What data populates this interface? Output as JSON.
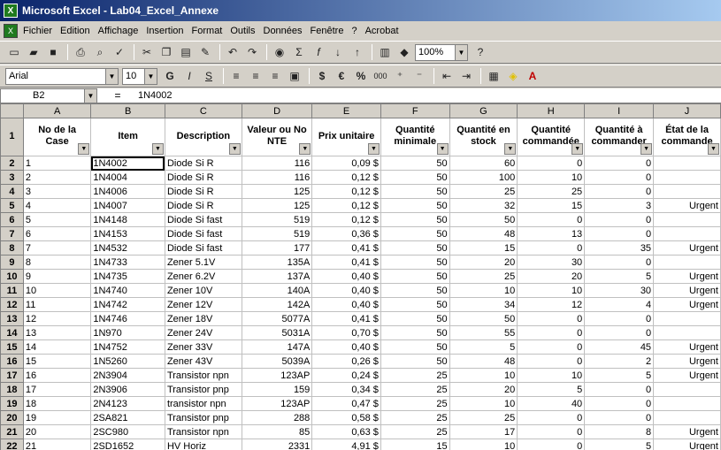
{
  "title": "Microsoft Excel - Lab04_Excel_Annexe",
  "menu": [
    "Fichier",
    "Edition",
    "Affichage",
    "Insertion",
    "Format",
    "Outils",
    "Données",
    "Fenêtre",
    "?",
    "Acrobat"
  ],
  "toolbar": {
    "zoom": "100%",
    "font": "Arial",
    "size": "10"
  },
  "formula": {
    "cell": "B2",
    "eq": "=",
    "value": "1N4002"
  },
  "columns": [
    "A",
    "B",
    "C",
    "D",
    "E",
    "F",
    "G",
    "H",
    "I",
    "J"
  ],
  "headers": [
    "No de la Case",
    "Item",
    "Description",
    "Valeur ou No NTE",
    "Prix unitaire",
    "Quantité minimale",
    "Quantité en stock",
    "Quantité commandée",
    "Quantité à commander",
    "État de la commande"
  ],
  "rows": [
    [
      "1",
      "1N4002",
      "Diode Si R",
      "116",
      "0,09 $",
      "50",
      "60",
      "0",
      "0",
      ""
    ],
    [
      "2",
      "1N4004",
      "Diode Si R",
      "116",
      "0,12 $",
      "50",
      "100",
      "10",
      "0",
      ""
    ],
    [
      "3",
      "1N4006",
      "Diode Si R",
      "125",
      "0,12 $",
      "50",
      "25",
      "25",
      "0",
      ""
    ],
    [
      "4",
      "1N4007",
      "Diode Si R",
      "125",
      "0,12 $",
      "50",
      "32",
      "15",
      "3",
      "Urgent"
    ],
    [
      "5",
      "1N4148",
      "Diode Si fast",
      "519",
      "0,12 $",
      "50",
      "50",
      "0",
      "0",
      ""
    ],
    [
      "6",
      "1N4153",
      "Diode Si fast",
      "519",
      "0,36 $",
      "50",
      "48",
      "13",
      "0",
      ""
    ],
    [
      "7",
      "1N4532",
      "Diode Si fast",
      "177",
      "0,41 $",
      "50",
      "15",
      "0",
      "35",
      "Urgent"
    ],
    [
      "8",
      "1N4733",
      "Zener 5.1V",
      "135A",
      "0,41 $",
      "50",
      "20",
      "30",
      "0",
      ""
    ],
    [
      "9",
      "1N4735",
      "Zener 6.2V",
      "137A",
      "0,40 $",
      "50",
      "25",
      "20",
      "5",
      "Urgent"
    ],
    [
      "10",
      "1N4740",
      "Zener 10V",
      "140A",
      "0,40 $",
      "50",
      "10",
      "10",
      "30",
      "Urgent"
    ],
    [
      "11",
      "1N4742",
      "Zener 12V",
      "142A",
      "0,40 $",
      "50",
      "34",
      "12",
      "4",
      "Urgent"
    ],
    [
      "12",
      "1N4746",
      "Zener 18V",
      "5077A",
      "0,41 $",
      "50",
      "50",
      "0",
      "0",
      ""
    ],
    [
      "13",
      "1N970",
      "Zener 24V",
      "5031A",
      "0,70 $",
      "50",
      "55",
      "0",
      "0",
      ""
    ],
    [
      "14",
      "1N4752",
      "Zener 33V",
      "147A",
      "0,40 $",
      "50",
      "5",
      "0",
      "45",
      "Urgent"
    ],
    [
      "15",
      "1N5260",
      "Zener 43V",
      "5039A",
      "0,26 $",
      "50",
      "48",
      "0",
      "2",
      "Urgent"
    ],
    [
      "16",
      "2N3904",
      "Transistor npn",
      "123AP",
      "0,24 $",
      "25",
      "10",
      "10",
      "5",
      "Urgent"
    ],
    [
      "17",
      "2N3906",
      "Transistor pnp",
      "159",
      "0,34 $",
      "25",
      "20",
      "5",
      "0",
      ""
    ],
    [
      "18",
      "2N4123",
      "transistor npn",
      "123AP",
      "0,47 $",
      "25",
      "10",
      "40",
      "0",
      ""
    ],
    [
      "19",
      "2SA821",
      "Transistor pnp",
      "288",
      "0,58 $",
      "25",
      "25",
      "0",
      "0",
      ""
    ],
    [
      "20",
      "2SC980",
      "Transistor npn",
      "85",
      "0,63 $",
      "25",
      "17",
      "0",
      "8",
      "Urgent"
    ],
    [
      "21",
      "2SD1652",
      "HV Horiz",
      "2331",
      "4,91 $",
      "15",
      "10",
      "0",
      "5",
      "Urgent"
    ]
  ]
}
